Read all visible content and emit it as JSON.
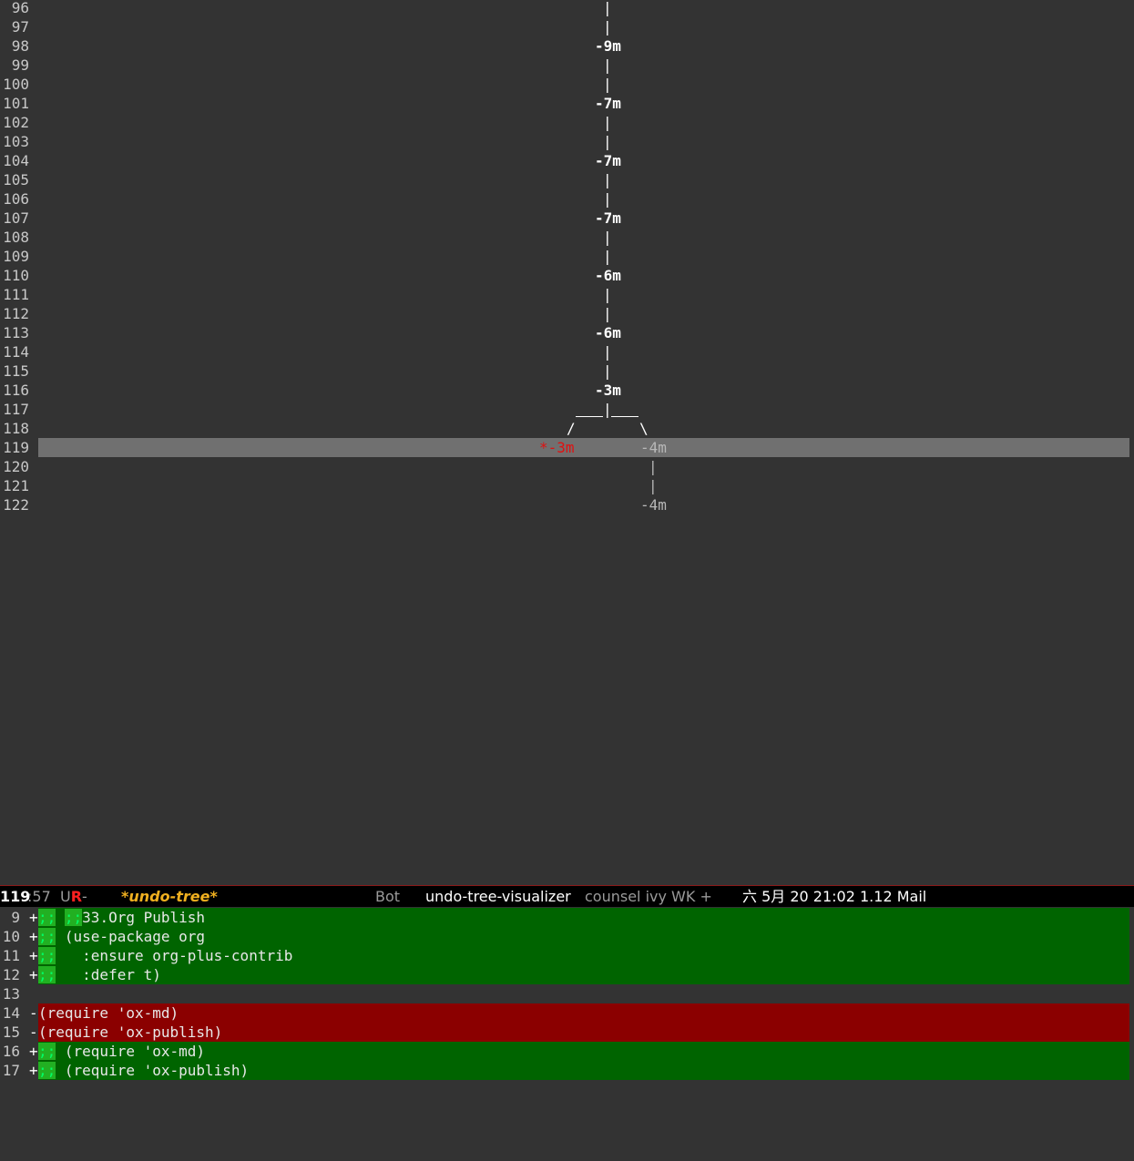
{
  "tree": {
    "line_numbers": [
      "96",
      "97",
      "98",
      "99",
      "100",
      "101",
      "102",
      "103",
      "104",
      "105",
      "106",
      "107",
      "108",
      "109",
      "110",
      "111",
      "112",
      "113",
      "114",
      "115",
      "116",
      "117",
      "118",
      "119",
      "120",
      "121",
      "122"
    ],
    "nodes": [
      {
        "label": "-9m"
      },
      {
        "label": "-7m"
      },
      {
        "label": "-7m"
      },
      {
        "label": "-7m"
      },
      {
        "label": "-6m"
      },
      {
        "label": "-6m"
      },
      {
        "label": "-3m"
      }
    ],
    "branch_left_label": "*-3m",
    "branch_right_label": "-4m",
    "branch_right_child_label": "-4m",
    "current_line": "119"
  },
  "modeline": {
    "line": "119",
    "column": ":57",
    "state_prefix": " U",
    "state_flag": "R",
    "state_suffix": "-",
    "buffer": "*undo-tree*",
    "position": "Bot",
    "major_mode": "undo-tree-visualizer",
    "minor_modes": "counsel ivy WK +",
    "time": "六 5月 20 21:02 1.12 Mail"
  },
  "diff": {
    "rows": [
      {
        "num": "9",
        "sign": "+",
        "type": "add",
        "marker": ";;",
        "marker2": ";;",
        "text": "33.Org Publish"
      },
      {
        "num": "10",
        "sign": "+",
        "type": "add",
        "marker": ";;",
        "marker2": "",
        "text": " (use-package org"
      },
      {
        "num": "11",
        "sign": "+",
        "type": "add",
        "marker": ";;",
        "marker2": "",
        "text": "   :ensure org-plus-contrib"
      },
      {
        "num": "12",
        "sign": "+",
        "type": "add",
        "marker": ";;",
        "marker2": "",
        "text": "   :defer t)"
      },
      {
        "num": "13",
        "sign": "",
        "type": "ctx",
        "marker": "",
        "marker2": "",
        "text": ""
      },
      {
        "num": "14",
        "sign": "-",
        "type": "del",
        "marker": "",
        "marker2": "",
        "text": "(require 'ox-md)"
      },
      {
        "num": "15",
        "sign": "-",
        "type": "del",
        "marker": "",
        "marker2": "",
        "text": "(require 'ox-publish)"
      },
      {
        "num": "16",
        "sign": "+",
        "type": "add",
        "marker": ";;",
        "marker2": "",
        "text": " (require 'ox-md)"
      },
      {
        "num": "17",
        "sign": "+",
        "type": "add",
        "marker": ";;",
        "marker2": "",
        "text": " (require 'ox-publish)"
      }
    ]
  },
  "colors": {
    "background": "#333333",
    "added": "#006400",
    "removed": "#8b0000",
    "current_node": "#e01010",
    "buffer_name": "#f0b020"
  }
}
